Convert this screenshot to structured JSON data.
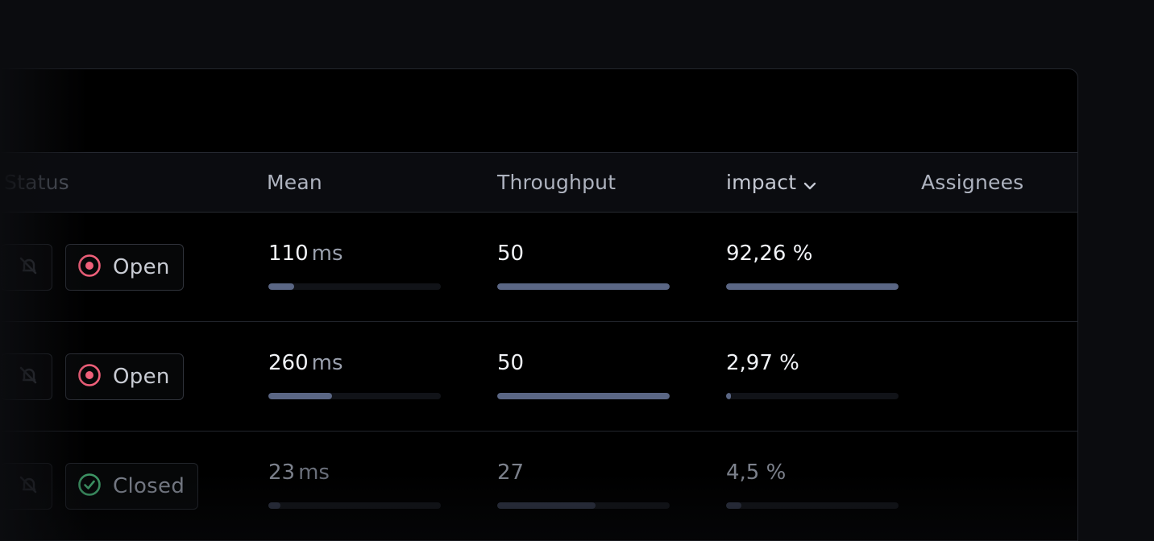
{
  "columns": {
    "status": "Status",
    "mean": "Mean",
    "throughput": "Throughput",
    "impact": "impact",
    "assignees": "Assignees"
  },
  "rows": [
    {
      "status": "Open",
      "status_icon": "open-circle-icon",
      "mean": "110",
      "mean_unit": "ms",
      "mean_level": 0.15,
      "throughput": "50",
      "throughput_level": 1.0,
      "impact": "92,26 %",
      "impact_level": 1.0
    },
    {
      "status": "Open",
      "status_icon": "open-circle-icon",
      "mean": "260",
      "mean_unit": "ms",
      "mean_level": 0.37,
      "throughput": "50",
      "throughput_level": 1.0,
      "impact": "2,97 %",
      "impact_level": 0.03
    },
    {
      "status": "Closed",
      "status_icon": "check-circle-icon",
      "mean": "23",
      "mean_unit": "ms",
      "mean_level": 0.07,
      "throughput": "27",
      "throughput_level": 0.57,
      "impact": "4,5 %",
      "impact_level": 0.09
    }
  ],
  "colors": {
    "open": "#f0607a",
    "closed": "#3f9a68",
    "bar_fill": "#5a6684",
    "bar_track": "#111318",
    "background": "#0b0c0f"
  }
}
